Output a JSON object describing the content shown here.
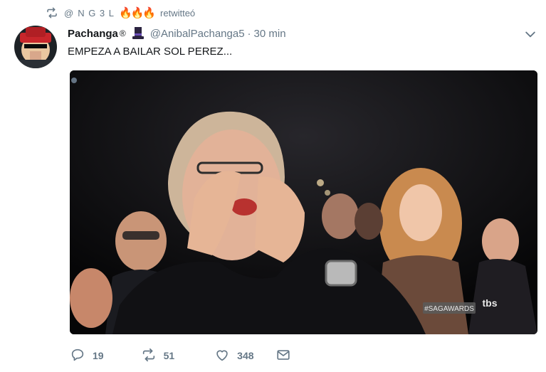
{
  "retweet_context": {
    "user": "N G 3 L",
    "emojis": "🔥🔥🔥",
    "label": "retwitteó"
  },
  "tweet": {
    "display_name": "Pachanga",
    "registered_mark": "®",
    "handle": "@AnibalPachanga5",
    "separator": "·",
    "timestamp": "30 min",
    "text": "EMPEZA A BAILAR SOL PEREZ...",
    "media_watermark": "#SAGAWARDS",
    "media_network_logo": "tbs"
  },
  "actions": {
    "replies": "19",
    "retweets": "51",
    "likes": "348"
  },
  "icons": {
    "retweet_context": "retweet-icon",
    "hat": "top-hat-icon",
    "caret": "chevron-down-icon",
    "reply": "reply-icon",
    "retweet": "retweet-icon",
    "like": "heart-icon",
    "dm": "envelope-icon"
  },
  "colors": {
    "text_primary": "#14171a",
    "text_secondary": "#657786"
  }
}
